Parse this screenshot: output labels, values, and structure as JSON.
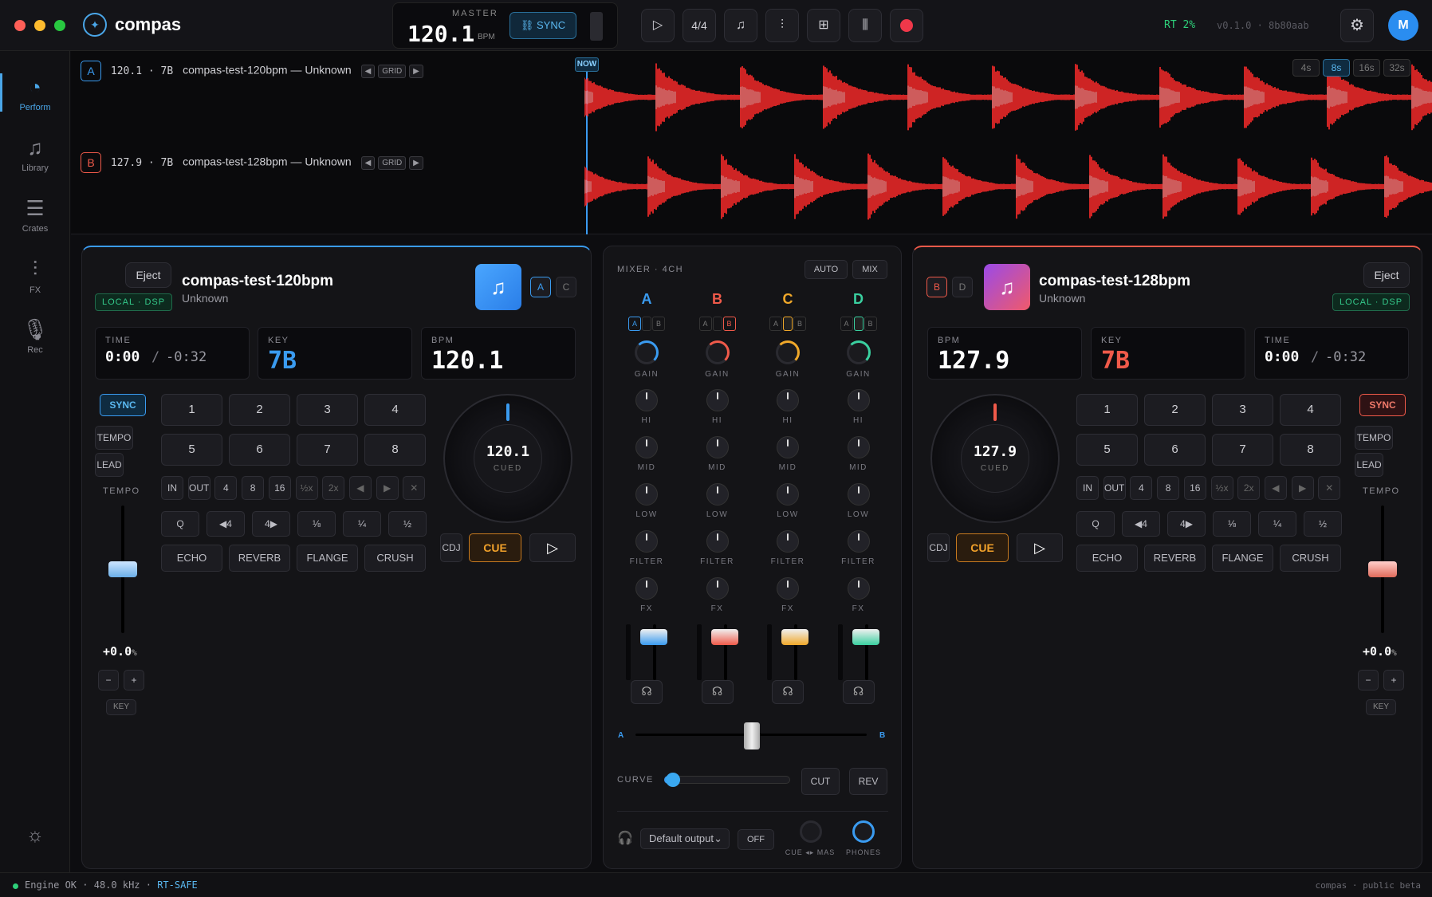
{
  "app": {
    "name": "compas",
    "version": "v0.1.0 · 8b80aab",
    "rt": "RT 2%",
    "avatar": "M"
  },
  "master": {
    "label": "MASTER",
    "bpm": "120.1",
    "unit": "BPM",
    "sync": "SYNC"
  },
  "toolbar": {
    "meter": "4/4"
  },
  "sidebar": [
    {
      "label": "Perform"
    },
    {
      "label": "Library"
    },
    {
      "label": "Crates"
    },
    {
      "label": "FX"
    },
    {
      "label": "Rec"
    }
  ],
  "tracks": {
    "now": "NOW",
    "grid": "GRID",
    "zoom": [
      "4s",
      "8s",
      "16s",
      "32s"
    ],
    "a": {
      "letter": "A",
      "info": "120.1 · 7B",
      "title": "compas-test-120bpm — Unknown"
    },
    "b": {
      "letter": "B",
      "info": "127.9 · 7B",
      "title": "compas-test-128bpm — Unknown"
    }
  },
  "deck_a": {
    "eject": "Eject",
    "badge": "LOCAL · DSP",
    "title": "compas-test-120bpm",
    "artist": "Unknown",
    "deck_letters": [
      "A",
      "C"
    ],
    "time_label": "TIME",
    "time": "0:00",
    "remaining": "-0:32",
    "key_label": "KEY",
    "key": "7B",
    "bpm_label": "BPM",
    "bpm": "120.1",
    "sync": "SYNC",
    "tempo_btn": "TEMPO",
    "lead": "LEAD",
    "tempo_label": "TEMPO",
    "pitch": "+0.0",
    "pitch_unit": "%",
    "minus": "−",
    "plus": "+",
    "key_btn": "KEY",
    "pads": [
      "1",
      "2",
      "3",
      "4",
      "5",
      "6",
      "7",
      "8"
    ],
    "loop": [
      "IN",
      "OUT",
      "4",
      "8",
      "16",
      "½x",
      "2x",
      "◀",
      "▶",
      "✕"
    ],
    "beat": [
      "Q",
      "◀4",
      "4▶",
      "⅛",
      "¼",
      "½"
    ],
    "fx": [
      "ECHO",
      "REVERB",
      "FLANGE",
      "CRUSH"
    ],
    "jog_bpm": "120.1",
    "jog_state": "CUED",
    "cdj": "CDJ",
    "cue": "CUE"
  },
  "deck_b": {
    "eject": "Eject",
    "badge": "LOCAL · DSP",
    "title": "compas-test-128bpm",
    "artist": "Unknown",
    "deck_letters": [
      "B",
      "D"
    ],
    "time_label": "TIME",
    "time": "0:00",
    "remaining": "-0:32",
    "key_label": "KEY",
    "key": "7B",
    "bpm_label": "BPM",
    "bpm": "127.9",
    "sync": "SYNC",
    "tempo_btn": "TEMPO",
    "lead": "LEAD",
    "tempo_label": "TEMPO",
    "pitch": "+0.0",
    "pitch_unit": "%",
    "minus": "−",
    "plus": "+",
    "key_btn": "KEY",
    "pads": [
      "1",
      "2",
      "3",
      "4",
      "5",
      "6",
      "7",
      "8"
    ],
    "loop": [
      "IN",
      "OUT",
      "4",
      "8",
      "16",
      "½x",
      "2x",
      "◀",
      "▶",
      "✕"
    ],
    "beat": [
      "Q",
      "◀4",
      "4▶",
      "⅛",
      "¼",
      "½"
    ],
    "fx": [
      "ECHO",
      "REVERB",
      "FLANGE",
      "CRUSH"
    ],
    "jog_bpm": "127.9",
    "jog_state": "CUED",
    "cdj": "CDJ",
    "cue": "CUE"
  },
  "mixer": {
    "title": "MIXER · 4CH",
    "auto": "AUTO",
    "mix": "MIX",
    "channels": [
      {
        "name": "A",
        "color": "#3a9bf0"
      },
      {
        "name": "B",
        "color": "#f05a4a"
      },
      {
        "name": "C",
        "color": "#f0a82a"
      },
      {
        "name": "D",
        "color": "#3ad0a0"
      }
    ],
    "assign": [
      "A",
      "B"
    ],
    "knob_labels": [
      "GAIN",
      "HI",
      "MID",
      "LOW",
      "FILTER",
      "FX"
    ],
    "xfade_a": "A",
    "xfade_b": "B",
    "curve": "CURVE",
    "cut": "CUT",
    "rev": "REV",
    "output": "Default output",
    "off": "OFF",
    "cue_mas": "CUE ◂▸ MAS",
    "phones": "PHONES"
  },
  "status": {
    "engine": "Engine OK",
    "rate": "48.0 kHz",
    "rt": "RT-SAFE",
    "right": "compas · public beta"
  }
}
